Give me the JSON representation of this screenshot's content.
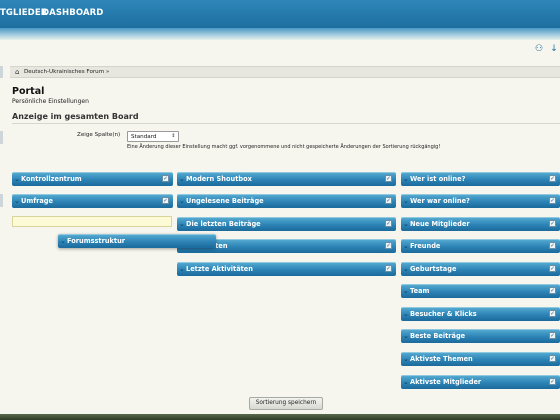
{
  "nav": {
    "items": [
      "TGLIEDER",
      "DASHBOARD"
    ]
  },
  "controls": {
    "up_icon": "sitemap-icon",
    "down_icon": "arrow-down-icon"
  },
  "breadcrumb": {
    "home_icon": "home-icon",
    "items": [
      "Deutsch-Ukrainisches Forum »"
    ]
  },
  "page": {
    "title": "Portal",
    "subtitle": "Persönliche Einstellungen",
    "section_title": "Anzeige im gesamten Board"
  },
  "columns_setting": {
    "label": "Zeige Spalte(n)",
    "selected": "Standard",
    "note": "Eine Änderung dieser Einstellung macht ggf. vorgenommene und nicht gespeicherte Änderungen der Sortierung rückgängig!"
  },
  "blocks": {
    "col1": [
      "Kontrollzentrum",
      "Umfrage"
    ],
    "dragging": "Forumsstruktur",
    "col2": [
      "Modern Shoutbox",
      "Ungelesene Beiträge",
      "Die letzten Beiträge",
      "iten",
      "Letzte Aktivitäten"
    ],
    "col3": [
      "Wer ist online?",
      "Wer war online?",
      "Neue Mitglieder",
      "Freunde",
      "Geburtstage",
      "Team",
      "Besucher & Klicks",
      "Beste Beiträge",
      "Aktivste Themen",
      "Aktivste Mitglieder"
    ]
  },
  "save_button": "Sortierung speichern",
  "colors": {
    "nav": "#1d6f9f",
    "block": "#2d83b5",
    "background": "#f6f5ee",
    "placeholder": "#fdfbd6"
  }
}
